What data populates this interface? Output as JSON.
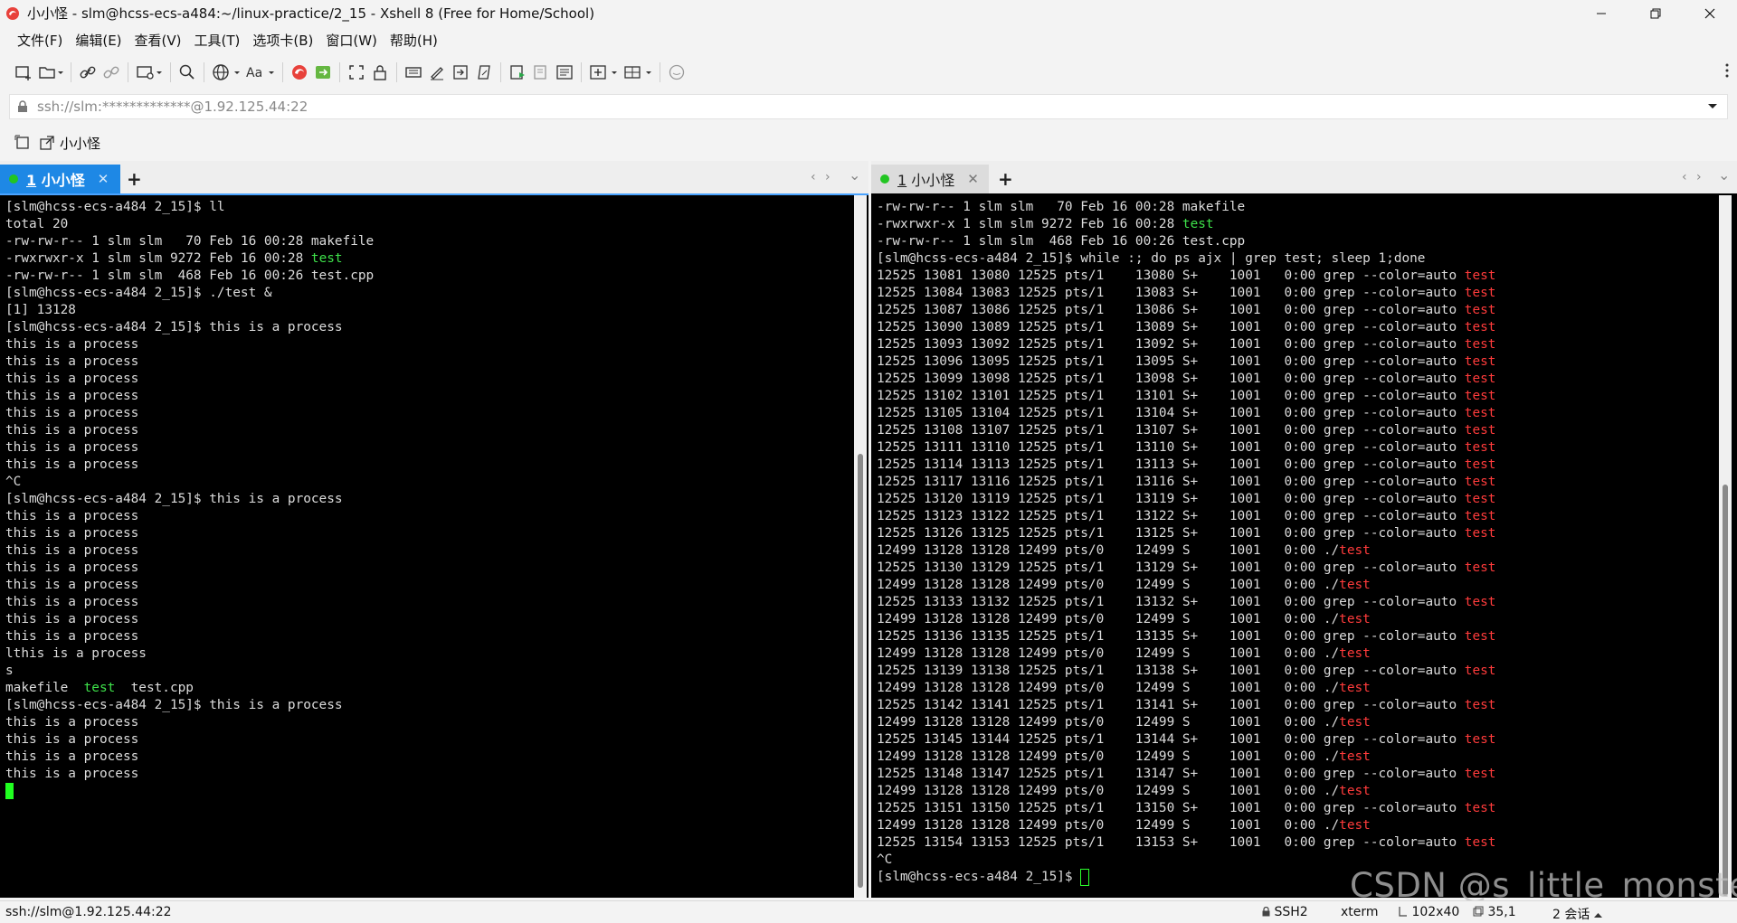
{
  "window": {
    "title": "小小怪 - slm@hcss-ecs-a484:~/linux-practice/2_15 - Xshell 8 (Free for Home/School)"
  },
  "menu": [
    "文件(F)",
    "编辑(E)",
    "查看(V)",
    "工具(T)",
    "选项卡(B)",
    "窗口(W)",
    "帮助(H)"
  ],
  "address": {
    "value": "ssh://slm:*************@1.92.125.44:22"
  },
  "quickbar": {
    "session_label": "小小怪"
  },
  "left_tab": {
    "number": "1",
    "name": "小小怪",
    "close": "✕",
    "add": "+"
  },
  "right_tab": {
    "number": "1",
    "name": "小小怪",
    "close": "✕",
    "add": "+"
  },
  "tab_nav": {
    "prev": "‹",
    "next": "›",
    "menu": "⌄"
  },
  "left_terminal": [
    [
      {
        "t": "[slm@hcss-ecs-a484 2_15]$ ll"
      }
    ],
    [
      {
        "t": "total 20"
      }
    ],
    [
      {
        "t": "-rw-rw-r-- 1 slm slm   70 Feb 16 00:28 makefile"
      }
    ],
    [
      {
        "t": "-rwxrwxr-x 1 slm slm 9272 Feb 16 00:28 "
      },
      {
        "t": "test",
        "c": "green"
      }
    ],
    [
      {
        "t": "-rw-rw-r-- 1 slm slm  468 Feb 16 00:26 test.cpp"
      }
    ],
    [
      {
        "t": "[slm@hcss-ecs-a484 2_15]$ ./test &"
      }
    ],
    [
      {
        "t": "[1] 13128"
      }
    ],
    [
      {
        "t": "[slm@hcss-ecs-a484 2_15]$ this is a process"
      }
    ],
    [
      {
        "t": "this is a process"
      }
    ],
    [
      {
        "t": "this is a process"
      }
    ],
    [
      {
        "t": "this is a process"
      }
    ],
    [
      {
        "t": "this is a process"
      }
    ],
    [
      {
        "t": "this is a process"
      }
    ],
    [
      {
        "t": "this is a process"
      }
    ],
    [
      {
        "t": "this is a process"
      }
    ],
    [
      {
        "t": "this is a process"
      }
    ],
    [
      {
        "t": "^C"
      }
    ],
    [
      {
        "t": "[slm@hcss-ecs-a484 2_15]$ this is a process"
      }
    ],
    [
      {
        "t": "this is a process"
      }
    ],
    [
      {
        "t": "this is a process"
      }
    ],
    [
      {
        "t": "this is a process"
      }
    ],
    [
      {
        "t": "this is a process"
      }
    ],
    [
      {
        "t": "this is a process"
      }
    ],
    [
      {
        "t": "this is a process"
      }
    ],
    [
      {
        "t": "this is a process"
      }
    ],
    [
      {
        "t": "this is a process"
      }
    ],
    [
      {
        "t": "lthis is a process"
      }
    ],
    [
      {
        "t": "s"
      }
    ],
    [
      {
        "t": "makefile  "
      },
      {
        "t": "test",
        "c": "green"
      },
      {
        "t": "  test.cpp"
      }
    ],
    [
      {
        "t": "[slm@hcss-ecs-a484 2_15]$ this is a process"
      }
    ],
    [
      {
        "t": "this is a process"
      }
    ],
    [
      {
        "t": "this is a process"
      }
    ],
    [
      {
        "t": "this is a process"
      }
    ],
    [
      {
        "t": "this is a process"
      }
    ],
    [
      {
        "t": "",
        "cursor": "solid"
      }
    ]
  ],
  "right_terminal": [
    [
      {
        "t": "-rw-rw-r-- 1 slm slm   70 Feb 16 00:28 makefile"
      }
    ],
    [
      {
        "t": "-rwxrwxr-x 1 slm slm 9272 Feb 16 00:28 "
      },
      {
        "t": "test",
        "c": "green"
      }
    ],
    [
      {
        "t": "-rw-rw-r-- 1 slm slm  468 Feb 16 00:26 test.cpp"
      }
    ],
    [
      {
        "t": "[slm@hcss-ecs-a484 2_15]$ while :; do ps ajx | grep test; sleep 1;done"
      }
    ],
    [
      {
        "t": "12525 13081 13080 12525 pts/1    13080 S+    1001   0:00 grep --color=auto "
      },
      {
        "t": "test",
        "c": "red"
      }
    ],
    [
      {
        "t": "12525 13084 13083 12525 pts/1    13083 S+    1001   0:00 grep --color=auto "
      },
      {
        "t": "test",
        "c": "red"
      }
    ],
    [
      {
        "t": "12525 13087 13086 12525 pts/1    13086 S+    1001   0:00 grep --color=auto "
      },
      {
        "t": "test",
        "c": "red"
      }
    ],
    [
      {
        "t": "12525 13090 13089 12525 pts/1    13089 S+    1001   0:00 grep --color=auto "
      },
      {
        "t": "test",
        "c": "red"
      }
    ],
    [
      {
        "t": "12525 13093 13092 12525 pts/1    13092 S+    1001   0:00 grep --color=auto "
      },
      {
        "t": "test",
        "c": "red"
      }
    ],
    [
      {
        "t": "12525 13096 13095 12525 pts/1    13095 S+    1001   0:00 grep --color=auto "
      },
      {
        "t": "test",
        "c": "red"
      }
    ],
    [
      {
        "t": "12525 13099 13098 12525 pts/1    13098 S+    1001   0:00 grep --color=auto "
      },
      {
        "t": "test",
        "c": "red"
      }
    ],
    [
      {
        "t": "12525 13102 13101 12525 pts/1    13101 S+    1001   0:00 grep --color=auto "
      },
      {
        "t": "test",
        "c": "red"
      }
    ],
    [
      {
        "t": "12525 13105 13104 12525 pts/1    13104 S+    1001   0:00 grep --color=auto "
      },
      {
        "t": "test",
        "c": "red"
      }
    ],
    [
      {
        "t": "12525 13108 13107 12525 pts/1    13107 S+    1001   0:00 grep --color=auto "
      },
      {
        "t": "test",
        "c": "red"
      }
    ],
    [
      {
        "t": "12525 13111 13110 12525 pts/1    13110 S+    1001   0:00 grep --color=auto "
      },
      {
        "t": "test",
        "c": "red"
      }
    ],
    [
      {
        "t": "12525 13114 13113 12525 pts/1    13113 S+    1001   0:00 grep --color=auto "
      },
      {
        "t": "test",
        "c": "red"
      }
    ],
    [
      {
        "t": "12525 13117 13116 12525 pts/1    13116 S+    1001   0:00 grep --color=auto "
      },
      {
        "t": "test",
        "c": "red"
      }
    ],
    [
      {
        "t": "12525 13120 13119 12525 pts/1    13119 S+    1001   0:00 grep --color=auto "
      },
      {
        "t": "test",
        "c": "red"
      }
    ],
    [
      {
        "t": "12525 13123 13122 12525 pts/1    13122 S+    1001   0:00 grep --color=auto "
      },
      {
        "t": "test",
        "c": "red"
      }
    ],
    [
      {
        "t": "12525 13126 13125 12525 pts/1    13125 S+    1001   0:00 grep --color=auto "
      },
      {
        "t": "test",
        "c": "red"
      }
    ],
    [
      {
        "t": "12499 13128 13128 12499 pts/0    12499 S     1001   0:00 ./"
      },
      {
        "t": "test",
        "c": "red"
      }
    ],
    [
      {
        "t": "12525 13130 13129 12525 pts/1    13129 S+    1001   0:00 grep --color=auto "
      },
      {
        "t": "test",
        "c": "red"
      }
    ],
    [
      {
        "t": "12499 13128 13128 12499 pts/0    12499 S     1001   0:00 ./"
      },
      {
        "t": "test",
        "c": "red"
      }
    ],
    [
      {
        "t": "12525 13133 13132 12525 pts/1    13132 S+    1001   0:00 grep --color=auto "
      },
      {
        "t": "test",
        "c": "red"
      }
    ],
    [
      {
        "t": "12499 13128 13128 12499 pts/0    12499 S     1001   0:00 ./"
      },
      {
        "t": "test",
        "c": "red"
      }
    ],
    [
      {
        "t": "12525 13136 13135 12525 pts/1    13135 S+    1001   0:00 grep --color=auto "
      },
      {
        "t": "test",
        "c": "red"
      }
    ],
    [
      {
        "t": "12499 13128 13128 12499 pts/0    12499 S     1001   0:00 ./"
      },
      {
        "t": "test",
        "c": "red"
      }
    ],
    [
      {
        "t": "12525 13139 13138 12525 pts/1    13138 S+    1001   0:00 grep --color=auto "
      },
      {
        "t": "test",
        "c": "red"
      }
    ],
    [
      {
        "t": "12499 13128 13128 12499 pts/0    12499 S     1001   0:00 ./"
      },
      {
        "t": "test",
        "c": "red"
      }
    ],
    [
      {
        "t": "12525 13142 13141 12525 pts/1    13141 S+    1001   0:00 grep --color=auto "
      },
      {
        "t": "test",
        "c": "red"
      }
    ],
    [
      {
        "t": "12499 13128 13128 12499 pts/0    12499 S     1001   0:00 ./"
      },
      {
        "t": "test",
        "c": "red"
      }
    ],
    [
      {
        "t": "12525 13145 13144 12525 pts/1    13144 S+    1001   0:00 grep --color=auto "
      },
      {
        "t": "test",
        "c": "red"
      }
    ],
    [
      {
        "t": "12499 13128 13128 12499 pts/0    12499 S     1001   0:00 ./"
      },
      {
        "t": "test",
        "c": "red"
      }
    ],
    [
      {
        "t": "12525 13148 13147 12525 pts/1    13147 S+    1001   0:00 grep --color=auto "
      },
      {
        "t": "test",
        "c": "red"
      }
    ],
    [
      {
        "t": "12499 13128 13128 12499 pts/0    12499 S     1001   0:00 ./"
      },
      {
        "t": "test",
        "c": "red"
      }
    ],
    [
      {
        "t": "12525 13151 13150 12525 pts/1    13150 S+    1001   0:00 grep --color=auto "
      },
      {
        "t": "test",
        "c": "red"
      }
    ],
    [
      {
        "t": "12499 13128 13128 12499 pts/0    12499 S     1001   0:00 ./"
      },
      {
        "t": "test",
        "c": "red"
      }
    ],
    [
      {
        "t": "12525 13154 13153 12525 pts/1    13153 S+    1001   0:00 grep --color=auto "
      },
      {
        "t": "test",
        "c": "red"
      }
    ],
    [
      {
        "t": "^C"
      }
    ],
    [
      {
        "t": "[slm@hcss-ecs-a484 2_15]$ "
      },
      {
        "t": "",
        "cursor": "hollow"
      }
    ]
  ],
  "status": {
    "connection": "ssh://slm@1.92.125.44:22",
    "protocol": "SSH2",
    "terminal_type": "xterm",
    "size": "102x40",
    "position": "35,1",
    "sessions": "2 会话"
  },
  "watermark": "CSDN @s_little_monster_",
  "colors": {
    "active_tab": "#1e88e5",
    "terminal_bg": "#000000",
    "green_text": "#3ee14a",
    "red_text": "#ff3b3b",
    "session_dot": "#22c522"
  }
}
